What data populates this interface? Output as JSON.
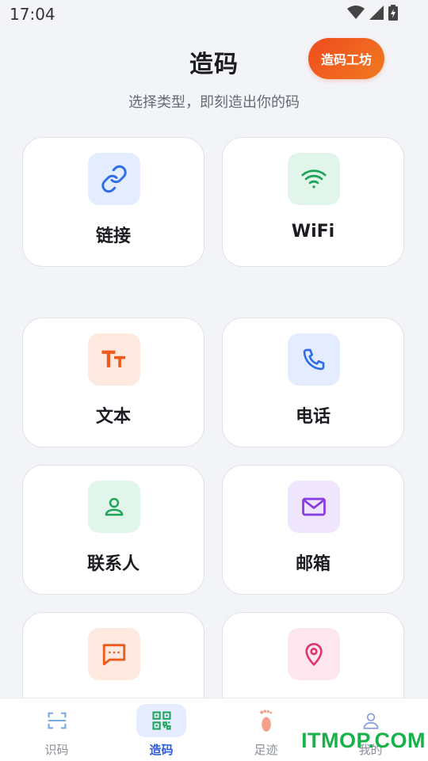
{
  "status_bar": {
    "time": "17:04"
  },
  "header": {
    "title": "造码",
    "workshop_button": "造码工坊",
    "subtitle": "选择类型，即刻造出你的码"
  },
  "cards": [
    {
      "label": "链接",
      "icon": "link-icon"
    },
    {
      "label": "WiFi",
      "icon": "wifi-icon"
    },
    {
      "label": "文本",
      "icon": "text-icon"
    },
    {
      "label": "电话",
      "icon": "phone-icon"
    },
    {
      "label": "联系人",
      "icon": "contact-icon"
    },
    {
      "label": "邮箱",
      "icon": "mail-icon"
    },
    {
      "label": "",
      "icon": "message-icon"
    },
    {
      "label": "",
      "icon": "location-icon"
    }
  ],
  "nav": [
    {
      "label": "识码",
      "icon": "scan-icon",
      "active": false
    },
    {
      "label": "造码",
      "icon": "qr-code-icon",
      "active": true
    },
    {
      "label": "足迹",
      "icon": "footprint-icon",
      "active": false
    },
    {
      "label": "我的",
      "icon": "profile-icon",
      "active": false
    }
  ],
  "watermark": "ITMOP.COM",
  "colors": {
    "accent": "#2f5bd8",
    "brand_orange": "#f0561f",
    "background": "#f3f4f8"
  }
}
